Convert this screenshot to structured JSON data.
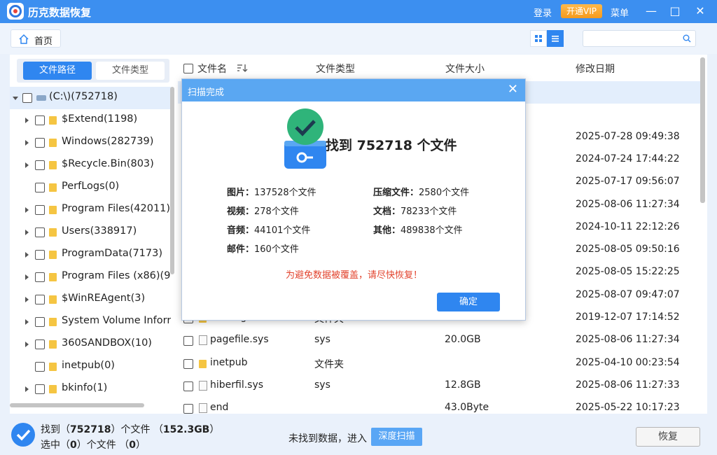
{
  "app": {
    "title": "历克数据恢复",
    "login": "登录",
    "vip": "开通VIP",
    "menu": "菜单"
  },
  "toolbar": {
    "home_label": "首页",
    "search_placeholder": ""
  },
  "left": {
    "tab_path": "文件路径",
    "tab_type": "文件类型",
    "tree": [
      {
        "label": "(C:\\)(752718)",
        "kind": "drive",
        "expanded": true,
        "indent": 0
      },
      {
        "label": "$Extend(1198)",
        "kind": "folder",
        "arrow": true,
        "indent": 1
      },
      {
        "label": "Windows(282739)",
        "kind": "folder",
        "arrow": true,
        "indent": 1
      },
      {
        "label": "$Recycle.Bin(803)",
        "kind": "folder",
        "arrow": true,
        "indent": 1
      },
      {
        "label": "PerfLogs(0)",
        "kind": "folder",
        "arrow": false,
        "indent": 1
      },
      {
        "label": "Program Files(42011)",
        "kind": "folder",
        "arrow": true,
        "indent": 1
      },
      {
        "label": "Users(338917)",
        "kind": "folder",
        "arrow": true,
        "indent": 1
      },
      {
        "label": "ProgramData(7173)",
        "kind": "folder",
        "arrow": true,
        "indent": 1
      },
      {
        "label": "Program Files (x86)(9",
        "kind": "folder",
        "arrow": true,
        "indent": 1
      },
      {
        "label": "$WinREAgent(3)",
        "kind": "folder",
        "arrow": true,
        "indent": 1
      },
      {
        "label": "System Volume Inforr",
        "kind": "folder",
        "arrow": true,
        "indent": 1
      },
      {
        "label": "360SANDBOX(10)",
        "kind": "folder",
        "arrow": true,
        "indent": 1
      },
      {
        "label": "inetpub(0)",
        "kind": "folder",
        "arrow": false,
        "indent": 1
      },
      {
        "label": "bkinfo(1)",
        "kind": "folder",
        "arrow": true,
        "indent": 1
      }
    ]
  },
  "table": {
    "headers": {
      "name": "文件名",
      "type": "文件类型",
      "size": "文件大小",
      "date": "修改日期"
    },
    "rows": [
      {
        "name": "",
        "type": "",
        "size": "",
        "date": "",
        "icon": "none"
      },
      {
        "name": "",
        "type": "",
        "size": "",
        "date": "",
        "icon": "none"
      },
      {
        "name": "",
        "type": "",
        "size": "",
        "date": "2025-07-28 09:49:38",
        "icon": "none"
      },
      {
        "name": "",
        "type": "",
        "size": "",
        "date": "2024-07-24 17:44:22",
        "icon": "none"
      },
      {
        "name": "",
        "type": "",
        "size": "",
        "date": "2025-07-17 09:56:07",
        "icon": "none"
      },
      {
        "name": "",
        "type": "",
        "size": "",
        "date": "2025-08-06 11:27:34",
        "icon": "none"
      },
      {
        "name": "",
        "type": "",
        "size": "",
        "date": "2024-10-11 22:12:26",
        "icon": "none"
      },
      {
        "name": "",
        "type": "",
        "size": "",
        "date": "2025-08-05 09:50:16",
        "icon": "none"
      },
      {
        "name": "",
        "type": "",
        "size": "",
        "date": "2025-08-05 15:22:25",
        "icon": "none"
      },
      {
        "name": "",
        "type": "",
        "size": "",
        "date": "2025-08-07 09:47:07",
        "icon": "none"
      },
      {
        "name": "PerfLogs",
        "type": "文件夹",
        "size": "",
        "date": "2019-12-07 17:14:52",
        "icon": "folder"
      },
      {
        "name": "pagefile.sys",
        "type": "sys",
        "size": "20.0GB",
        "date": "2025-08-06 11:27:34",
        "icon": "file"
      },
      {
        "name": "inetpub",
        "type": "文件夹",
        "size": "",
        "date": "2025-04-10 00:23:54",
        "icon": "folder"
      },
      {
        "name": "hiberfil.sys",
        "type": "sys",
        "size": "12.8GB",
        "date": "2025-08-06 11:27:33",
        "icon": "file"
      },
      {
        "name": "end",
        "type": "",
        "size": "43.0Byte",
        "date": "2025-05-22 10:17:23",
        "icon": "file"
      }
    ]
  },
  "bottom": {
    "found_prefix": "找到（",
    "found_count": "752718",
    "found_mid": "）个文件 （",
    "found_size": "152.3GB",
    "found_suffix": "）",
    "sel_prefix": "选中（",
    "sel_count": "0",
    "sel_mid": "）个文件 （",
    "sel_size": "0",
    "sel_suffix": "）",
    "not_found": "未找到数据，进入",
    "deep_scan": "深度扫描",
    "recover": "恢复"
  },
  "dialog": {
    "title": "扫描完成",
    "found_text": "找到 752718 个文件",
    "stats_left": [
      {
        "k": "图片：",
        "v": "137528个文件"
      },
      {
        "k": "视频：",
        "v": "278个文件"
      },
      {
        "k": "音频：",
        "v": "44101个文件"
      },
      {
        "k": "邮件：",
        "v": "160个文件"
      }
    ],
    "stats_right": [
      {
        "k": "压缩文件：",
        "v": "2580个文件"
      },
      {
        "k": "文档：",
        "v": "78233个文件"
      },
      {
        "k": "其他：",
        "v": "489838个文件"
      }
    ],
    "warning": "为避免数据被覆盖，请尽快恢复！",
    "ok": "确定"
  },
  "colors": {
    "accent": "#2f86f0",
    "titlebar": "#3c8ff0",
    "warning": "#e2432d",
    "vip": "#f59a1d",
    "folder": "#f5c542"
  }
}
